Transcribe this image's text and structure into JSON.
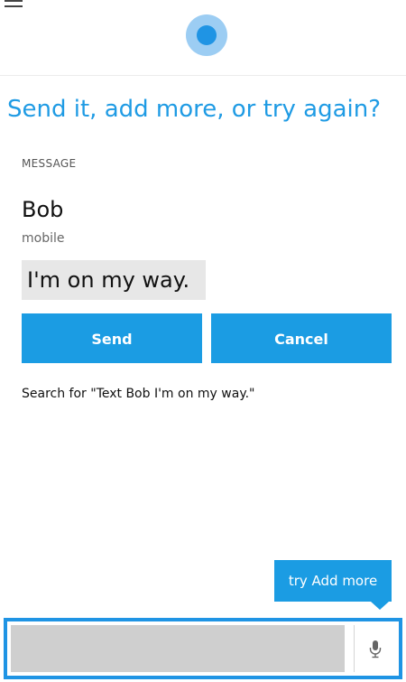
{
  "header": {
    "menu_icon": "hamburger-menu-icon",
    "assistant_icon": "cortana-ring-icon"
  },
  "prompt": "Send it, add more, or try again?",
  "section_label": "MESSAGE",
  "recipient": {
    "name": "Bob",
    "type": "mobile"
  },
  "message": {
    "text": "I'm on my way."
  },
  "buttons": {
    "send": "Send",
    "cancel": "Cancel"
  },
  "search_link": "Search for \"Text Bob I'm on my way.\"",
  "tooltip": "try Add more",
  "input": {
    "value": "",
    "placeholder": ""
  },
  "mic_icon": "microphone-icon",
  "colors": {
    "accent": "#1b9ce3",
    "accent_dark": "#1f94e4",
    "message_bg": "#e7e7e7"
  }
}
